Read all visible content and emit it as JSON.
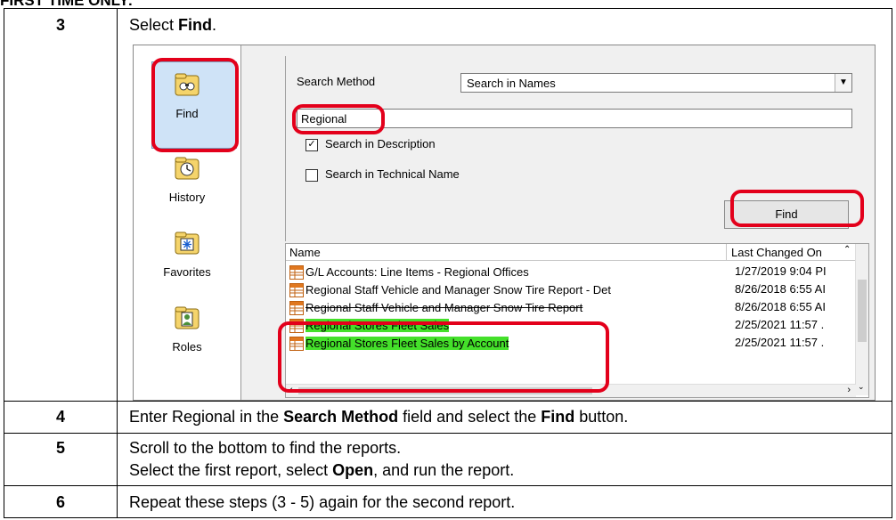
{
  "header": {
    "text": "FIRST TIME ONLY:"
  },
  "steps": [
    {
      "num": "3",
      "text_pre": "Select ",
      "text_bold": "Find",
      "text_post": "."
    },
    {
      "num": "4",
      "t1": "Enter Regional in the ",
      "b1": "Search Method",
      "t2": " field and select the ",
      "b2": "Find",
      "t3": " button."
    },
    {
      "num": "5",
      "line1": "Scroll to the bottom to find the reports.",
      "t1": "Select the first report, select ",
      "b1": "Open",
      "t2": ", and run the report."
    },
    {
      "num": "6",
      "text": "Repeat these steps (3 - 5) again for the second report."
    }
  ],
  "screenshot": {
    "sidebar": {
      "items": [
        {
          "label": "Find",
          "icon": "binoculars-folder-icon"
        },
        {
          "label": "History",
          "icon": "clock-folder-icon"
        },
        {
          "label": "Favorites",
          "icon": "star-folder-icon"
        },
        {
          "label": "Roles",
          "icon": "person-folder-icon"
        }
      ]
    },
    "search": {
      "method_label": "Search Method",
      "method_value": "Search in Names",
      "query_value": "Regional",
      "check_description_label": "Search in Description",
      "check_description_checked": true,
      "check_technical_label": "Search in Technical Name",
      "check_technical_checked": false,
      "find_button_label": "Find"
    },
    "results": {
      "columns": [
        "Name",
        "Last Changed On"
      ],
      "rows": [
        {
          "name": "G/L Accounts: Line Items - Regional Offices",
          "date": "1/27/2019 9:04 PI",
          "highlight": false,
          "strike": false
        },
        {
          "name": "Regional Staff Vehicle and Manager Snow Tire Report - Det",
          "date": "8/26/2018 6:55 AI",
          "highlight": false,
          "strike": false
        },
        {
          "name": "Regional Staff Vehicle and Manager Snow Tire Report",
          "date": "8/26/2018 6:55 AI",
          "highlight": false,
          "strike": true
        },
        {
          "name": "Regional Stores Fleet Sales",
          "date": "2/25/2021 11:57 .",
          "highlight": true,
          "strike": false
        },
        {
          "name": "Regional Stores Fleet Sales by Account",
          "date": "2/25/2021 11:57 .",
          "highlight": true,
          "strike": false
        }
      ]
    },
    "colors": {
      "callout": "#e3001b",
      "highlight": "#44e02a",
      "selection": "#cfe3f7"
    }
  }
}
